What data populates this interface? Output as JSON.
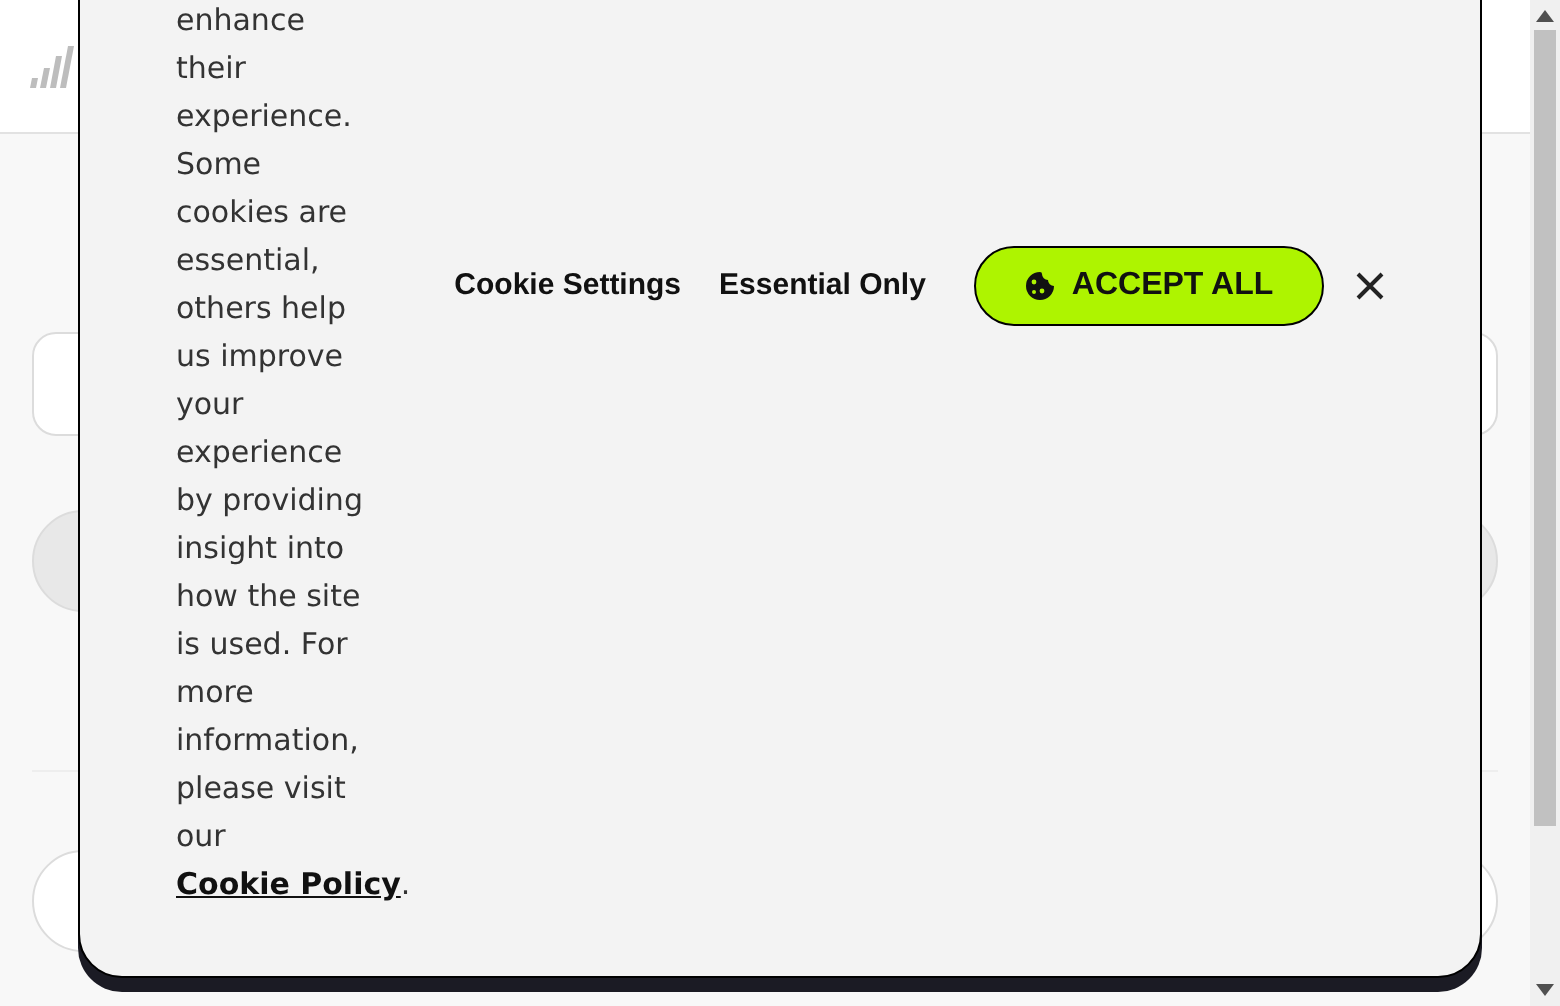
{
  "cookie_banner": {
    "message": "enhance their experience. Some cookies are essential, others help us improve your experience by providing insight into how the site is used. For more information, please visit our",
    "link": "Cookie Policy",
    "message_end": ".",
    "buttons": [
      {
        "kind": "text",
        "label": "Cookie Settings"
      },
      {
        "kind": "text",
        "label": "Essential Only"
      },
      {
        "kind": "primary",
        "label": "ACCEPT ALL"
      },
      {
        "kind": "close"
      }
    ]
  }
}
